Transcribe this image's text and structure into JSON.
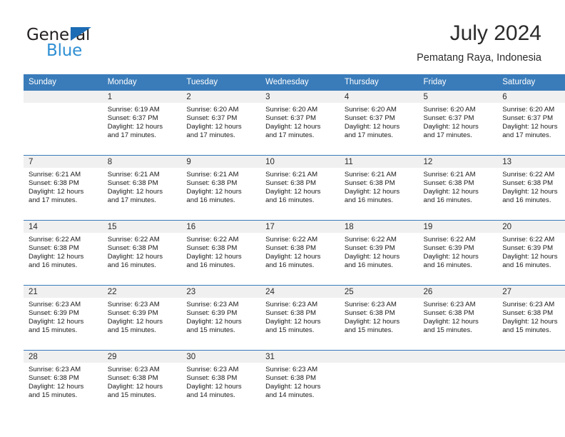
{
  "brand": {
    "name_part1": "General",
    "name_part2": "Blue",
    "triangle_color": "#1c6cb5",
    "blue_text_color": "#2e8fd4"
  },
  "header": {
    "title": "July 2024",
    "subtitle": "Pematang Raya, Indonesia"
  },
  "colors": {
    "header_row_bg": "#3a7cba",
    "header_row_text": "#ffffff",
    "daynum_band_bg": "#f0f0f0",
    "row_separator": "#3a7cba",
    "body_text": "#1a1a1a",
    "page_bg": "#ffffff"
  },
  "weekday_headers": [
    "Sunday",
    "Monday",
    "Tuesday",
    "Wednesday",
    "Thursday",
    "Friday",
    "Saturday"
  ],
  "weeks": [
    [
      {
        "day": "",
        "sunrise": "",
        "sunset": "",
        "daylight_line1": "",
        "daylight_line2": ""
      },
      {
        "day": "1",
        "sunrise": "Sunrise: 6:19 AM",
        "sunset": "Sunset: 6:37 PM",
        "daylight_line1": "Daylight: 12 hours",
        "daylight_line2": "and 17 minutes."
      },
      {
        "day": "2",
        "sunrise": "Sunrise: 6:20 AM",
        "sunset": "Sunset: 6:37 PM",
        "daylight_line1": "Daylight: 12 hours",
        "daylight_line2": "and 17 minutes."
      },
      {
        "day": "3",
        "sunrise": "Sunrise: 6:20 AM",
        "sunset": "Sunset: 6:37 PM",
        "daylight_line1": "Daylight: 12 hours",
        "daylight_line2": "and 17 minutes."
      },
      {
        "day": "4",
        "sunrise": "Sunrise: 6:20 AM",
        "sunset": "Sunset: 6:37 PM",
        "daylight_line1": "Daylight: 12 hours",
        "daylight_line2": "and 17 minutes."
      },
      {
        "day": "5",
        "sunrise": "Sunrise: 6:20 AM",
        "sunset": "Sunset: 6:37 PM",
        "daylight_line1": "Daylight: 12 hours",
        "daylight_line2": "and 17 minutes."
      },
      {
        "day": "6",
        "sunrise": "Sunrise: 6:20 AM",
        "sunset": "Sunset: 6:37 PM",
        "daylight_line1": "Daylight: 12 hours",
        "daylight_line2": "and 17 minutes."
      }
    ],
    [
      {
        "day": "7",
        "sunrise": "Sunrise: 6:21 AM",
        "sunset": "Sunset: 6:38 PM",
        "daylight_line1": "Daylight: 12 hours",
        "daylight_line2": "and 17 minutes."
      },
      {
        "day": "8",
        "sunrise": "Sunrise: 6:21 AM",
        "sunset": "Sunset: 6:38 PM",
        "daylight_line1": "Daylight: 12 hours",
        "daylight_line2": "and 17 minutes."
      },
      {
        "day": "9",
        "sunrise": "Sunrise: 6:21 AM",
        "sunset": "Sunset: 6:38 PM",
        "daylight_line1": "Daylight: 12 hours",
        "daylight_line2": "and 16 minutes."
      },
      {
        "day": "10",
        "sunrise": "Sunrise: 6:21 AM",
        "sunset": "Sunset: 6:38 PM",
        "daylight_line1": "Daylight: 12 hours",
        "daylight_line2": "and 16 minutes."
      },
      {
        "day": "11",
        "sunrise": "Sunrise: 6:21 AM",
        "sunset": "Sunset: 6:38 PM",
        "daylight_line1": "Daylight: 12 hours",
        "daylight_line2": "and 16 minutes."
      },
      {
        "day": "12",
        "sunrise": "Sunrise: 6:21 AM",
        "sunset": "Sunset: 6:38 PM",
        "daylight_line1": "Daylight: 12 hours",
        "daylight_line2": "and 16 minutes."
      },
      {
        "day": "13",
        "sunrise": "Sunrise: 6:22 AM",
        "sunset": "Sunset: 6:38 PM",
        "daylight_line1": "Daylight: 12 hours",
        "daylight_line2": "and 16 minutes."
      }
    ],
    [
      {
        "day": "14",
        "sunrise": "Sunrise: 6:22 AM",
        "sunset": "Sunset: 6:38 PM",
        "daylight_line1": "Daylight: 12 hours",
        "daylight_line2": "and 16 minutes."
      },
      {
        "day": "15",
        "sunrise": "Sunrise: 6:22 AM",
        "sunset": "Sunset: 6:38 PM",
        "daylight_line1": "Daylight: 12 hours",
        "daylight_line2": "and 16 minutes."
      },
      {
        "day": "16",
        "sunrise": "Sunrise: 6:22 AM",
        "sunset": "Sunset: 6:38 PM",
        "daylight_line1": "Daylight: 12 hours",
        "daylight_line2": "and 16 minutes."
      },
      {
        "day": "17",
        "sunrise": "Sunrise: 6:22 AM",
        "sunset": "Sunset: 6:38 PM",
        "daylight_line1": "Daylight: 12 hours",
        "daylight_line2": "and 16 minutes."
      },
      {
        "day": "18",
        "sunrise": "Sunrise: 6:22 AM",
        "sunset": "Sunset: 6:39 PM",
        "daylight_line1": "Daylight: 12 hours",
        "daylight_line2": "and 16 minutes."
      },
      {
        "day": "19",
        "sunrise": "Sunrise: 6:22 AM",
        "sunset": "Sunset: 6:39 PM",
        "daylight_line1": "Daylight: 12 hours",
        "daylight_line2": "and 16 minutes."
      },
      {
        "day": "20",
        "sunrise": "Sunrise: 6:22 AM",
        "sunset": "Sunset: 6:39 PM",
        "daylight_line1": "Daylight: 12 hours",
        "daylight_line2": "and 16 minutes."
      }
    ],
    [
      {
        "day": "21",
        "sunrise": "Sunrise: 6:23 AM",
        "sunset": "Sunset: 6:39 PM",
        "daylight_line1": "Daylight: 12 hours",
        "daylight_line2": "and 15 minutes."
      },
      {
        "day": "22",
        "sunrise": "Sunrise: 6:23 AM",
        "sunset": "Sunset: 6:39 PM",
        "daylight_line1": "Daylight: 12 hours",
        "daylight_line2": "and 15 minutes."
      },
      {
        "day": "23",
        "sunrise": "Sunrise: 6:23 AM",
        "sunset": "Sunset: 6:39 PM",
        "daylight_line1": "Daylight: 12 hours",
        "daylight_line2": "and 15 minutes."
      },
      {
        "day": "24",
        "sunrise": "Sunrise: 6:23 AM",
        "sunset": "Sunset: 6:38 PM",
        "daylight_line1": "Daylight: 12 hours",
        "daylight_line2": "and 15 minutes."
      },
      {
        "day": "25",
        "sunrise": "Sunrise: 6:23 AM",
        "sunset": "Sunset: 6:38 PM",
        "daylight_line1": "Daylight: 12 hours",
        "daylight_line2": "and 15 minutes."
      },
      {
        "day": "26",
        "sunrise": "Sunrise: 6:23 AM",
        "sunset": "Sunset: 6:38 PM",
        "daylight_line1": "Daylight: 12 hours",
        "daylight_line2": "and 15 minutes."
      },
      {
        "day": "27",
        "sunrise": "Sunrise: 6:23 AM",
        "sunset": "Sunset: 6:38 PM",
        "daylight_line1": "Daylight: 12 hours",
        "daylight_line2": "and 15 minutes."
      }
    ],
    [
      {
        "day": "28",
        "sunrise": "Sunrise: 6:23 AM",
        "sunset": "Sunset: 6:38 PM",
        "daylight_line1": "Daylight: 12 hours",
        "daylight_line2": "and 15 minutes."
      },
      {
        "day": "29",
        "sunrise": "Sunrise: 6:23 AM",
        "sunset": "Sunset: 6:38 PM",
        "daylight_line1": "Daylight: 12 hours",
        "daylight_line2": "and 15 minutes."
      },
      {
        "day": "30",
        "sunrise": "Sunrise: 6:23 AM",
        "sunset": "Sunset: 6:38 PM",
        "daylight_line1": "Daylight: 12 hours",
        "daylight_line2": "and 14 minutes."
      },
      {
        "day": "31",
        "sunrise": "Sunrise: 6:23 AM",
        "sunset": "Sunset: 6:38 PM",
        "daylight_line1": "Daylight: 12 hours",
        "daylight_line2": "and 14 minutes."
      },
      {
        "day": "",
        "sunrise": "",
        "sunset": "",
        "daylight_line1": "",
        "daylight_line2": ""
      },
      {
        "day": "",
        "sunrise": "",
        "sunset": "",
        "daylight_line1": "",
        "daylight_line2": ""
      },
      {
        "day": "",
        "sunrise": "",
        "sunset": "",
        "daylight_line1": "",
        "daylight_line2": ""
      }
    ]
  ]
}
